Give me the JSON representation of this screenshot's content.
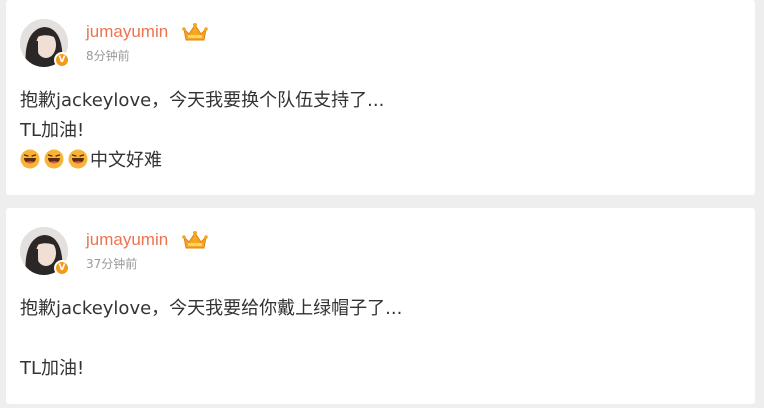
{
  "posts": [
    {
      "username": "jumayumin",
      "timestamp": "8分钟前",
      "badge": "V",
      "lines": [
        "抱歉jackeylove，今天我要换个队伍支持了...",
        "TL加油!"
      ],
      "emoji_line_text": "中文好难",
      "emoji_icons": [
        "laughing-face-icon",
        "laughing-face-icon",
        "laughing-face-icon"
      ]
    },
    {
      "username": "jumayumin",
      "timestamp": "37分钟前",
      "badge": "V",
      "lines": [
        "抱歉jackeylove，今天我要给你戴上绿帽子了...",
        "",
        "TL加油!"
      ]
    }
  ],
  "colors": {
    "username": "#eb7350",
    "timestamp": "#999999",
    "badge": "#f39a1b",
    "text": "#333333",
    "background": "#eeeeee",
    "card": "#ffffff"
  }
}
